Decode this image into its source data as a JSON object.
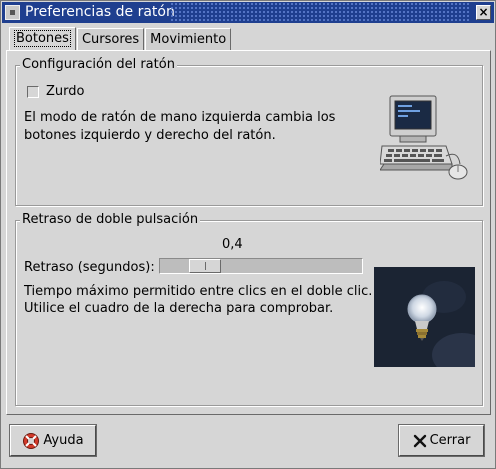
{
  "window": {
    "title": "Preferencias de ratón",
    "close_glyph": "×"
  },
  "tabs": [
    {
      "label": "Botones",
      "active": true
    },
    {
      "label": "Cursores",
      "active": false
    },
    {
      "label": "Movimiento",
      "active": false
    }
  ],
  "mouse_config": {
    "frame_title": "Configuración del ratón",
    "left_handed_label": "Zurdo",
    "left_handed_checked": false,
    "description_line1": "El modo de ratón de mano izquierda cambia los",
    "description_line2": "botones izquierdo y derecho del ratón.",
    "image_icon": "computer-mouse-icon"
  },
  "double_click": {
    "frame_title": "Retraso de doble pulsación",
    "slider_value": "0,4",
    "slider_label": "Retraso (segundos):",
    "slider_fraction": 0.4,
    "description_line1": "Tiempo máximo permitido entre clics en el doble clic.",
    "description_line2": "Utilice el cuadro de la derecha para comprobar.",
    "test_icon": "lightbulb-icon"
  },
  "buttons": {
    "help_label": "Ayuda",
    "close_label": "Cerrar"
  },
  "colors": {
    "titlebar": "#1f3f8f",
    "background": "#d6d6d6",
    "test_area": "#1b2433",
    "close_icon_red": "#b00000"
  }
}
